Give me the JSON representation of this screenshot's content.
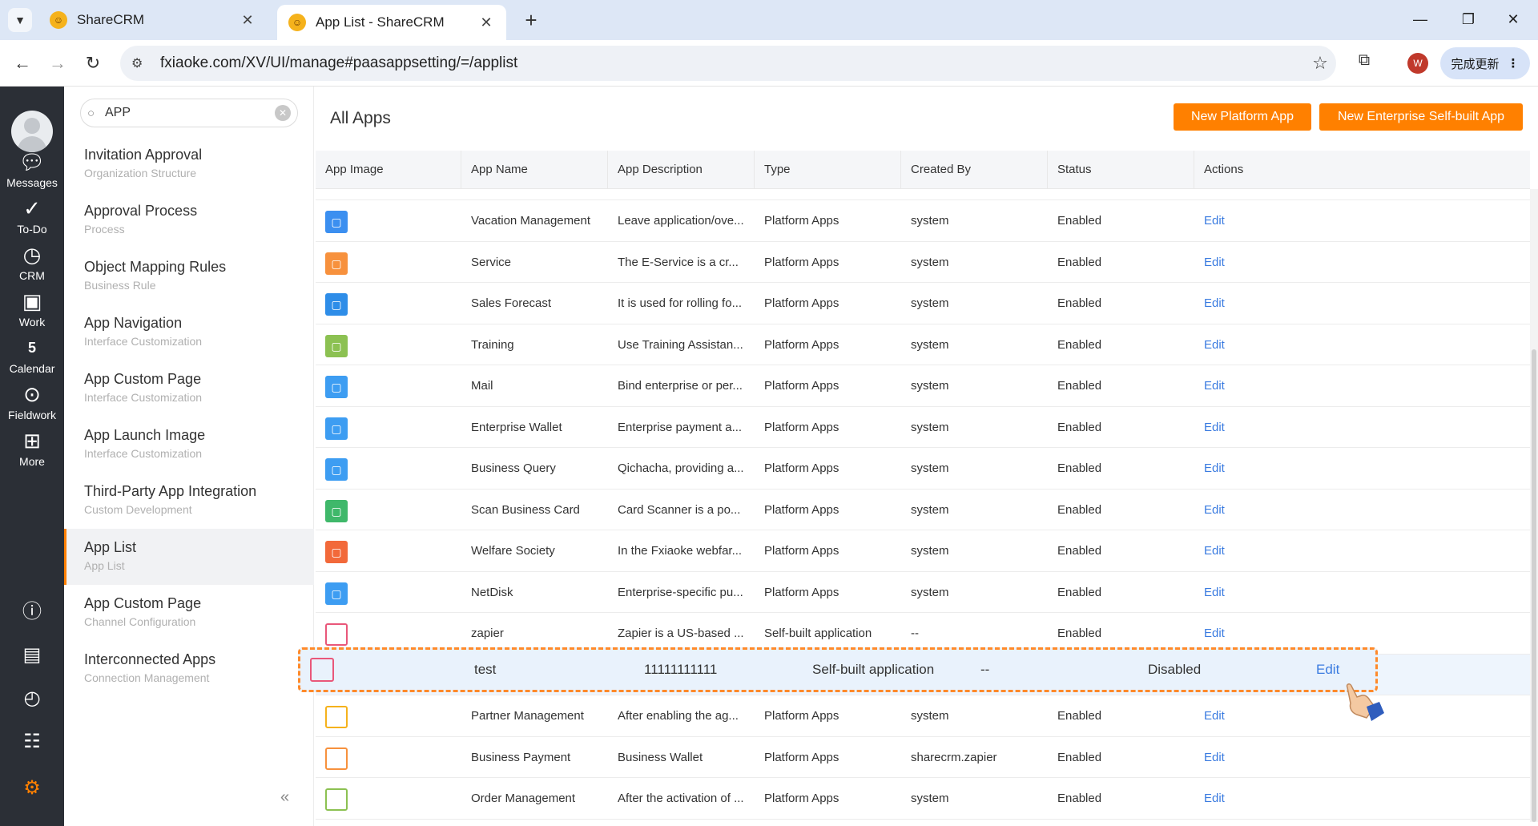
{
  "browser": {
    "tabs": [
      {
        "title": "ShareCRM"
      },
      {
        "title": "App List - ShareCRM"
      }
    ],
    "url": "fxiaoke.com/XV/UI/manage#paasappsetting/=/applist",
    "update_label": "完成更新",
    "profile_initial": "W"
  },
  "rail": {
    "items": [
      {
        "label": "Messages",
        "icon": "chat-bubble-icon"
      },
      {
        "label": "To-Do",
        "icon": "check-circle-icon"
      },
      {
        "label": "CRM",
        "icon": "clock-icon"
      },
      {
        "label": "Work",
        "icon": "briefcase-icon"
      },
      {
        "label": "Calendar",
        "icon": "calendar-icon",
        "day": "5"
      },
      {
        "label": "Fieldwork",
        "icon": "location-pin-icon"
      },
      {
        "label": "More",
        "icon": "grid-icon"
      }
    ],
    "accent_color": "#ff8000"
  },
  "sidebar": {
    "search_value": "APP",
    "items": [
      {
        "title": "Invitation Approval",
        "subtitle": "Organization Structure"
      },
      {
        "title": "Approval Process",
        "subtitle": "Process"
      },
      {
        "title": "Object Mapping Rules",
        "subtitle": "Business Rule"
      },
      {
        "title": "App Navigation",
        "subtitle": "Interface Customization"
      },
      {
        "title": "App Custom Page",
        "subtitle": "Interface Customization"
      },
      {
        "title": "App Launch Image",
        "subtitle": "Interface Customization"
      },
      {
        "title": "Third-Party App Integration",
        "subtitle": "Custom Development"
      },
      {
        "title": "App List",
        "subtitle": "App List"
      },
      {
        "title": "App Custom Page",
        "subtitle": "Channel Configuration"
      },
      {
        "title": "Interconnected Apps",
        "subtitle": "Connection Management"
      }
    ],
    "collapse_label": "«"
  },
  "main": {
    "title": "All Apps",
    "new_platform_label": "New Platform App",
    "new_selfbuilt_label": "New Enterprise Self-built App",
    "columns": [
      "App Image",
      "App Name",
      "App Description",
      "Type",
      "Created By",
      "Status",
      "Actions"
    ],
    "rows": [
      {
        "name": "Vacation Management",
        "desc": "Leave application/ove...",
        "type": "Platform Apps",
        "created_by": "system",
        "status": "Enabled",
        "action": "Edit",
        "icon_color": "#3b8ff0"
      },
      {
        "name": "Service",
        "desc": "The E-Service is a cr...",
        "type": "Platform Apps",
        "created_by": "system",
        "status": "Enabled",
        "action": "Edit",
        "icon_color": "#f7913d"
      },
      {
        "name": "Sales Forecast",
        "desc": "It is used for rolling fo...",
        "type": "Platform Apps",
        "created_by": "system",
        "status": "Enabled",
        "action": "Edit",
        "icon_color": "#2e8de8"
      },
      {
        "name": "Training",
        "desc": "Use Training Assistan...",
        "type": "Platform Apps",
        "created_by": "system",
        "status": "Enabled",
        "action": "Edit",
        "icon_color": "#8cc152"
      },
      {
        "name": "Mail",
        "desc": "Bind enterprise or per...",
        "type": "Platform Apps",
        "created_by": "system",
        "status": "Enabled",
        "action": "Edit",
        "icon_color": "#3d9df2"
      },
      {
        "name": "Enterprise Wallet",
        "desc": "Enterprise payment a...",
        "type": "Platform Apps",
        "created_by": "system",
        "status": "Enabled",
        "action": "Edit",
        "icon_color": "#3d9df2"
      },
      {
        "name": "Business Query",
        "desc": "Qichacha, providing a...",
        "type": "Platform Apps",
        "created_by": "system",
        "status": "Enabled",
        "action": "Edit",
        "icon_color": "#3d9df2"
      },
      {
        "name": "Scan Business Card",
        "desc": "Card Scanner is a po...",
        "type": "Platform Apps",
        "created_by": "system",
        "status": "Enabled",
        "action": "Edit",
        "icon_color": "#3fb86a"
      },
      {
        "name": "Welfare Society",
        "desc": "In the Fxiaoke webfar...",
        "type": "Platform Apps",
        "created_by": "system",
        "status": "Enabled",
        "action": "Edit",
        "icon_color": "#f2693a"
      },
      {
        "name": "NetDisk",
        "desc": "Enterprise-specific pu...",
        "type": "Platform Apps",
        "created_by": "system",
        "status": "Enabled",
        "action": "Edit",
        "icon_color": "#3d9df2"
      },
      {
        "name": "zapier",
        "desc": "Zapier is a US-based ...",
        "type": "Self-built application",
        "created_by": "--",
        "status": "Enabled",
        "action": "Edit",
        "icon_color": "#e9577a"
      },
      {
        "name": "",
        "desc": "",
        "type": "",
        "created_by": "",
        "status": "",
        "action": "",
        "icon_color": "#ffffff"
      },
      {
        "name": "Partner Management",
        "desc": "After enabling the ag...",
        "type": "Platform Apps",
        "created_by": "system",
        "status": "Enabled",
        "action": "Edit",
        "icon_color": "#f5b21c"
      },
      {
        "name": "Business Payment",
        "desc": "Business Wallet",
        "type": "Platform Apps",
        "created_by": "sharecrm.zapier",
        "status": "Enabled",
        "action": "Edit",
        "icon_color": "#f7913d"
      },
      {
        "name": "Order Management",
        "desc": "After the activation of ...",
        "type": "Platform Apps",
        "created_by": "system",
        "status": "Enabled",
        "action": "Edit",
        "icon_color": "#8cc152"
      }
    ],
    "highlighted_row": {
      "name": "test",
      "desc": "11111111111",
      "type": "Self-built application",
      "created_by": "--",
      "status": "Disabled",
      "action": "Edit",
      "border_color": "#ff8a2a"
    }
  }
}
